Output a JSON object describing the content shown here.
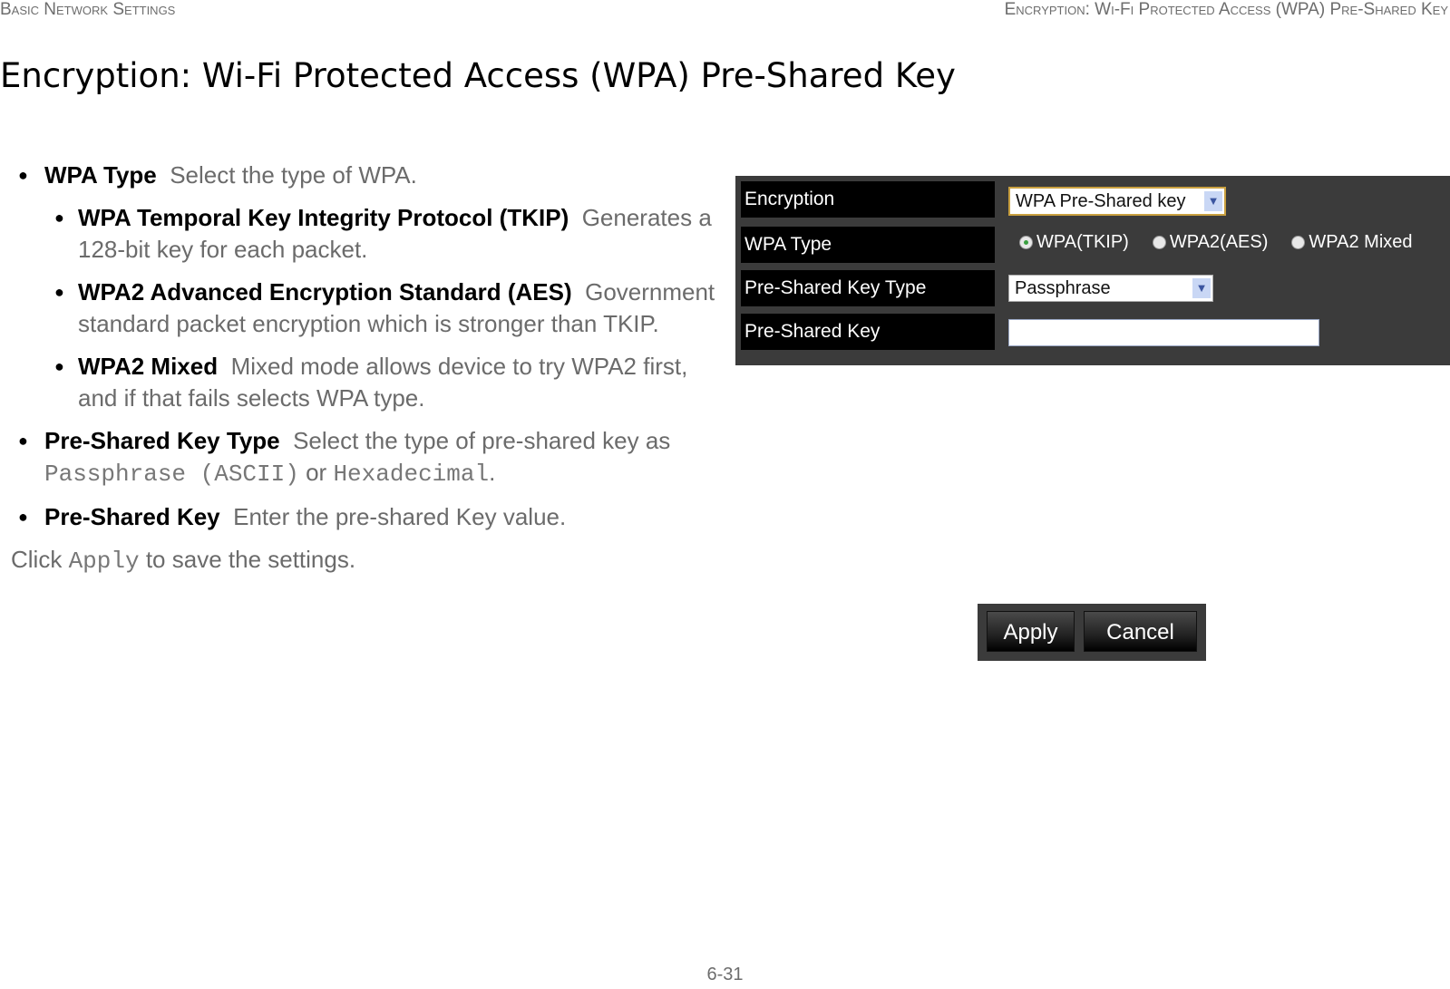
{
  "header": {
    "left": "Basic Network Settings",
    "right": "Encryption: Wi-Fi Protected Access (WPA) Pre-Shared Key"
  },
  "title": "Encryption: Wi-Fi Protected Access (WPA) Pre-Shared Key",
  "items": [
    {
      "term": "WPA Type",
      "desc": "Select the type of WPA.",
      "level": 1
    },
    {
      "term": "WPA Temporal Key Integrity Protocol (TKIP)",
      "desc": "Generates a 128-bit key for each packet.",
      "level": 2
    },
    {
      "term": "WPA2 Advanced Encryption Standard (AES)",
      "desc": "Government standard packet encryption which is stronger than TKIP.",
      "level": 2
    },
    {
      "term": "WPA2 Mixed",
      "desc": "Mixed mode allows device to try WPA2 first, and if that fails selects WPA type.",
      "level": 2
    },
    {
      "term": "Pre-Shared Key Type",
      "desc_before": "Select the type of pre-shared key as",
      "code1": "Passphrase (ASCII)",
      "mid": "or",
      "code2": "Hexadecimal",
      "end": ".",
      "level": 1
    },
    {
      "term": "Pre-Shared Key",
      "desc": "Enter the pre-shared Key value.",
      "level": 1
    }
  ],
  "click_line": {
    "before": "Click",
    "code": "Apply",
    "after": "to save the settings."
  },
  "form": {
    "labels": {
      "encryption": "Encryption",
      "wpa_type": "WPA Type",
      "psk_type": "Pre-Shared Key Type",
      "psk": "Pre-Shared Key"
    },
    "encryption_value": "WPA Pre-Shared key",
    "wpa_options": [
      {
        "label": "WPA(TKIP)",
        "selected": true
      },
      {
        "label": "WPA2(AES)",
        "selected": false
      },
      {
        "label": "WPA2 Mixed",
        "selected": false
      }
    ],
    "psk_type_value": "Passphrase",
    "psk_value": "",
    "dropdown_icon": "chevron-down-icon"
  },
  "buttons": {
    "apply": "Apply",
    "cancel": "Cancel"
  },
  "page_number": "6-31"
}
